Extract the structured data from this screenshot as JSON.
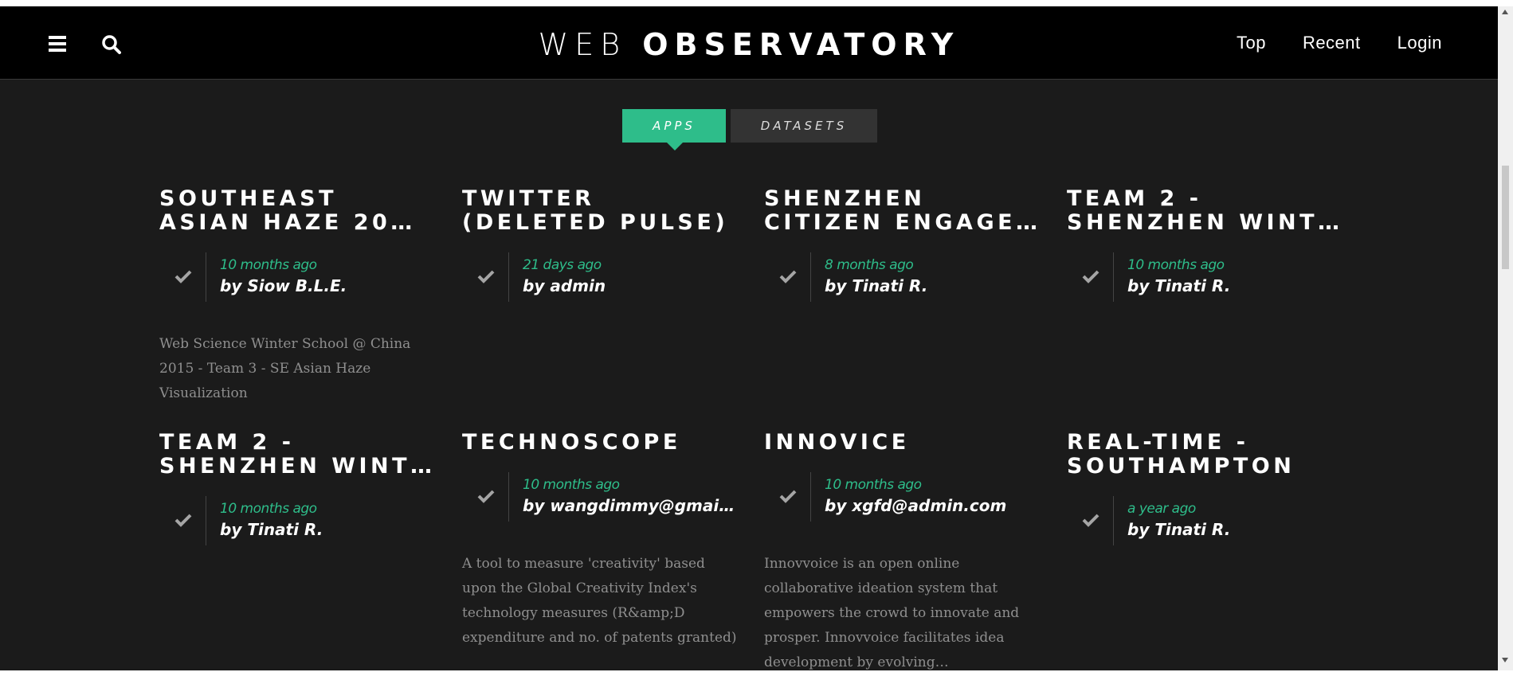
{
  "header": {
    "brand_part1": "WEB",
    "brand_part2": "OBSERVATORY",
    "nav": [
      "Top",
      "Recent",
      "Login"
    ]
  },
  "tabs": [
    {
      "label": "APPS",
      "active": true
    },
    {
      "label": "DATASETS",
      "active": false
    }
  ],
  "colors": {
    "accent": "#2ebd8a",
    "background": "#1b1b1b",
    "topbar": "#000000"
  },
  "icons": [
    "menu-icon",
    "search-icon",
    "check-icon"
  ],
  "cards": [
    {
      "title": "SOUTHEAST ASIAN HAZE 20…",
      "time": "10 months ago",
      "author": "by Siow B.L.E.",
      "description": "Web Science Winter School @ China 2015 - Team 3 - SE Asian Haze Visualization"
    },
    {
      "title": "TWITTER (DELETED PULSE)",
      "time": "21 days ago",
      "author": "by admin",
      "description": ""
    },
    {
      "title": "SHENZHEN CITIZEN ENGAGE…",
      "time": "8 months ago",
      "author": "by Tinati R.",
      "description": ""
    },
    {
      "title": "TEAM 2 - SHENZHEN WINT…",
      "time": "10 months ago",
      "author": "by Tinati R.",
      "description": ""
    },
    {
      "title": "TEAM 2 - SHENZHEN WINT…",
      "time": "10 months ago",
      "author": "by Tinati R.",
      "description": ""
    },
    {
      "title": "TECHNOSCOPE",
      "time": "10 months ago",
      "author": "by wangdimmy@gmai…",
      "description": "A tool to measure 'creativity' based upon the Global Creativity Index's technology measures (R&amp;D expenditure and no. of patents granted)"
    },
    {
      "title": "INNOVICE",
      "time": "10 months ago",
      "author": "by xgfd@admin.com",
      "description": "Innovvoice is an open online collaborative ideation system that empowers the crowd to innovate and prosper. Innovvoice facilitates idea development by evolving…"
    },
    {
      "title": "REAL-TIME - SOUTHAMPTON",
      "time": "a year ago",
      "author": "by Tinati R.",
      "description": ""
    }
  ]
}
